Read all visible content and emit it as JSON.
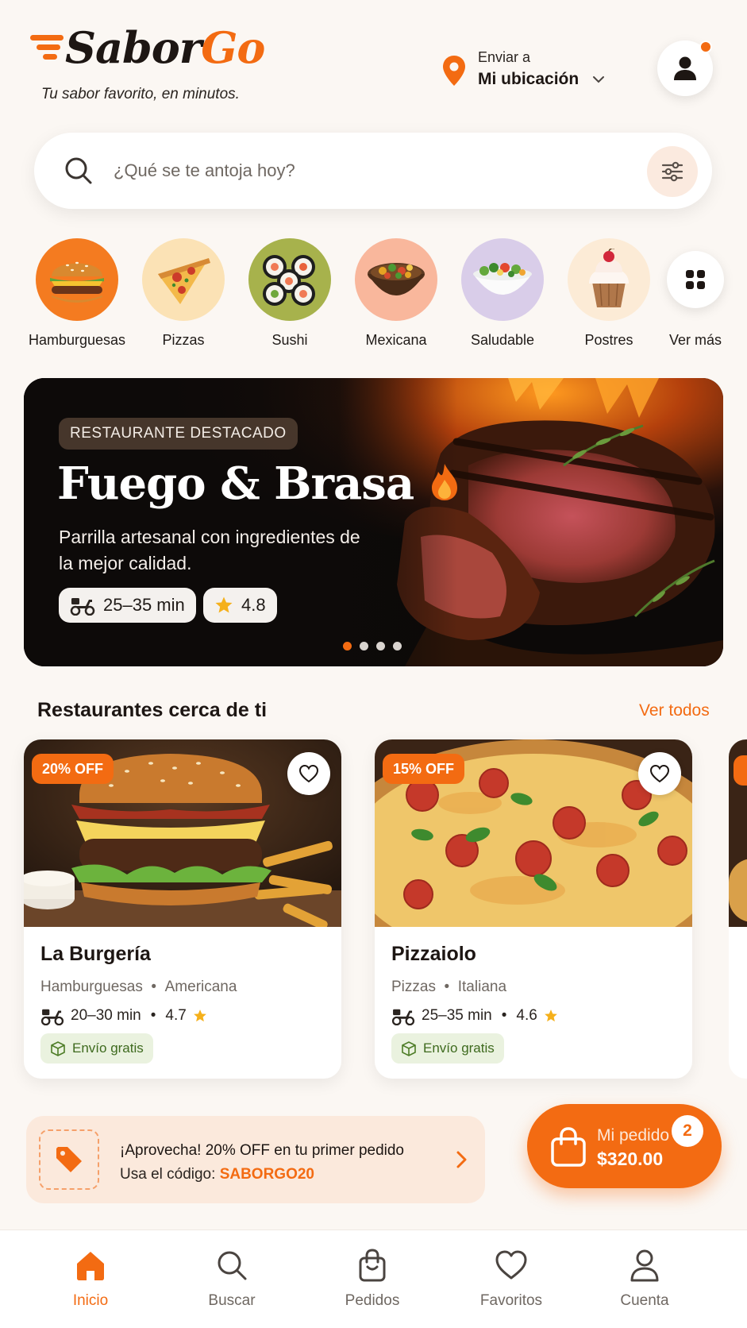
{
  "header": {
    "logo_part1": "Sabor",
    "logo_part2": "Go",
    "tagline": "Tu sabor favorito, en minutos.",
    "location_label": "Enviar a",
    "location_value": "Mi ubicación"
  },
  "search": {
    "placeholder": "¿Qué se te antoja hoy?"
  },
  "categories": [
    {
      "label": "Hamburguesas",
      "icon": "burger-icon",
      "bg": "#f47b20"
    },
    {
      "label": "Pizzas",
      "icon": "pizza-icon",
      "bg": "#fbe2b5"
    },
    {
      "label": "Sushi",
      "icon": "sushi-icon",
      "bg": "#a7b24c"
    },
    {
      "label": "Mexicana",
      "icon": "bowl-icon",
      "bg": "#f9b79c"
    },
    {
      "label": "Saludable",
      "icon": "salad-icon",
      "bg": "#d9cde9"
    },
    {
      "label": "Postres",
      "icon": "cupcake-icon",
      "bg": "#fcebd6"
    },
    {
      "label": "Ver más",
      "icon": "grid-icon",
      "bg": "#ffffff"
    }
  ],
  "hero": {
    "badge": "RESTAURANTE DESTACADO",
    "title": "Fuego & Brasa",
    "subtitle": "Parrilla artesanal con ingredientes de la mejor calidad.",
    "time": "25–35 min",
    "rating": "4.8",
    "slides": 4,
    "active_slide": 1
  },
  "nearby": {
    "title": "Restaurantes cerca de ti",
    "see_all": "Ver todos",
    "restaurants": [
      {
        "discount": "20% OFF",
        "name": "La Burgería",
        "category": "Hamburguesas",
        "cuisine": "Americana",
        "time": "20–30 min",
        "rating": "4.7",
        "badge": "Envío gratis"
      },
      {
        "discount": "15% OFF",
        "name": "Pizzaiolo",
        "category": "Pizzas",
        "cuisine": "Italiana",
        "time": "25–35 min",
        "rating": "4.6",
        "badge": "Envío gratis"
      }
    ]
  },
  "promo": {
    "line1": "¡Aprovecha! 20% OFF en tu primer pedido",
    "line2_prefix": "Usa el código: ",
    "code": "SABORGO20"
  },
  "cart": {
    "label": "Mi pedido",
    "total": "$320.00",
    "count": "2"
  },
  "nav": [
    {
      "label": "Inicio",
      "icon": "home-icon",
      "active": true
    },
    {
      "label": "Buscar",
      "icon": "search-icon",
      "active": false
    },
    {
      "label": "Pedidos",
      "icon": "bag-icon",
      "active": false
    },
    {
      "label": "Favoritos",
      "icon": "heart-icon",
      "active": false
    },
    {
      "label": "Cuenta",
      "icon": "user-icon",
      "active": false
    }
  ],
  "colors": {
    "accent": "#f36b12",
    "background": "#fbf7f3",
    "free_badge_bg": "#eaf2df",
    "free_badge_text": "#3e6a1e"
  }
}
